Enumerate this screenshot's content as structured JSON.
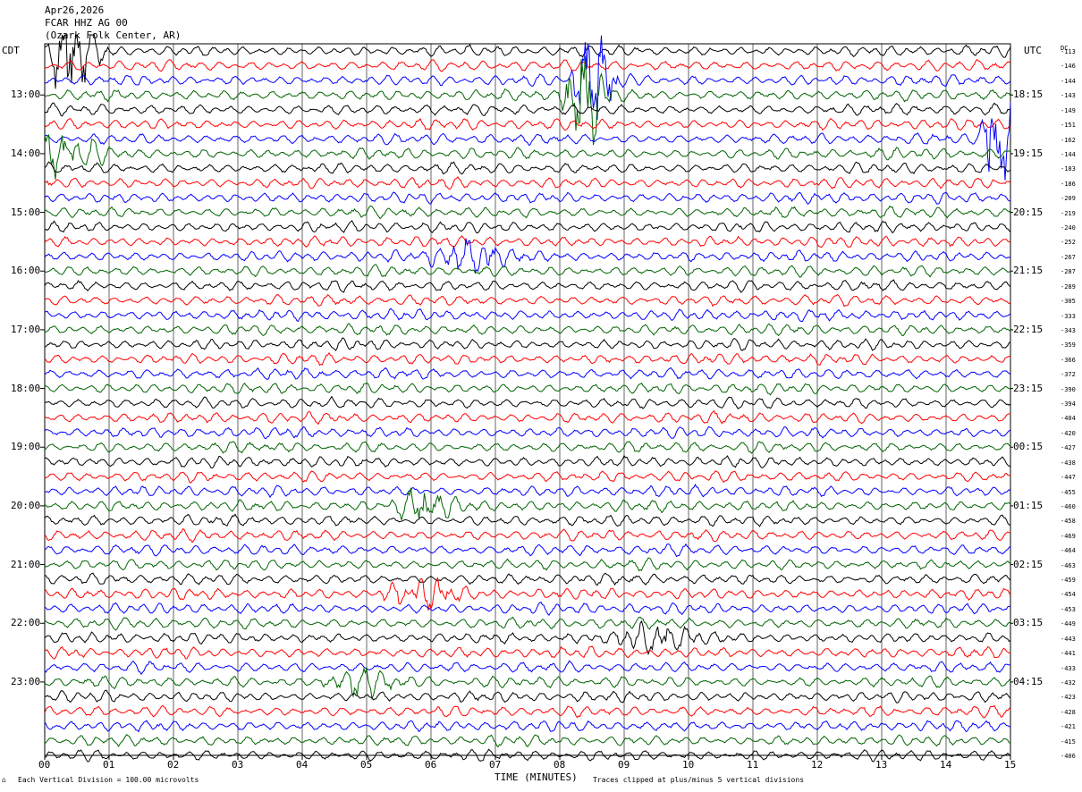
{
  "header": {
    "date": "Apr26,2026",
    "channel": "FCAR HHZ AG 00",
    "station": "(Ozark Folk Center, AR)"
  },
  "left_axis_title": "CDT",
  "right_axis_title": "UTC",
  "dc_title": "DC",
  "footer": {
    "scale_note": "Each Vertical Division =  100.00 microvolts",
    "xlabel": "TIME (MINUTES)",
    "clip_note": "Traces clipped at plus/minus 5 vertical divisions"
  },
  "colors": {
    "black": "#000000",
    "red": "#ff0000",
    "blue": "#0000ff",
    "green": "#006400",
    "grid": "#000000"
  },
  "chart_data": {
    "type": "line",
    "title": "FCAR HHZ AG 00 (Ozark Folk Center, AR)",
    "xlabel": "TIME (MINUTES)",
    "xlim": [
      0,
      15
    ],
    "x_ticks": [
      "00",
      "01",
      "02",
      "03",
      "04",
      "05",
      "06",
      "07",
      "08",
      "09",
      "10",
      "11",
      "12",
      "13",
      "14",
      "15"
    ],
    "trace_minutes": 15,
    "traces_per_hour": 4,
    "trace_color_cycle": [
      "black",
      "red",
      "blue",
      "green"
    ],
    "left_hour_labels": [
      "13:00",
      "14:00",
      "15:00",
      "16:00",
      "17:00",
      "18:00",
      "19:00",
      "20:00",
      "21:00",
      "22:00",
      "23:00"
    ],
    "right_hour_labels": [
      "18:15",
      "19:15",
      "20:15",
      "21:15",
      "22:15",
      "23:15",
      "00:15",
      "01:15",
      "02:15",
      "03:15",
      "04:15"
    ],
    "dc_offsets": [
      -113,
      -146,
      -144,
      -143,
      -149,
      -151,
      -162,
      -144,
      -183,
      -186,
      -209,
      -219,
      -240,
      -252,
      -267,
      -287,
      -289,
      -305,
      -333,
      -343,
      -359,
      -366,
      -372,
      -390,
      -394,
      -404,
      -420,
      -427,
      -438,
      -447,
      -455,
      -460,
      -458,
      -469,
      -464,
      -463,
      -459,
      -454,
      -453,
      -449,
      -443,
      -441,
      -433,
      -432,
      -423,
      -428,
      -421,
      -415,
      -406
    ],
    "events": [
      {
        "trace": 0,
        "x_minutes": 0.45,
        "strength": 5,
        "color": "black"
      },
      {
        "trace": 3,
        "x_minutes": 8.35,
        "strength": 5,
        "color": "green"
      },
      {
        "trace": 2,
        "x_minutes": 8.55,
        "strength": 4,
        "color": "blue"
      },
      {
        "trace": 6,
        "x_minutes": 14.85,
        "strength": 5,
        "color": "blue"
      },
      {
        "trace": 7,
        "x_minutes": 0.2,
        "strength": 2,
        "color": "green"
      },
      {
        "trace": 14,
        "x_minutes": 6.6,
        "strength": 1.5,
        "color": "blue"
      },
      {
        "trace": 31,
        "x_minutes": 5.9,
        "strength": 1.5,
        "color": "green"
      },
      {
        "trace": 37,
        "x_minutes": 5.8,
        "strength": 1.5,
        "color": "red"
      },
      {
        "trace": 40,
        "x_minutes": 9.5,
        "strength": 1.5,
        "color": "black"
      },
      {
        "trace": 43,
        "x_minutes": 4.9,
        "strength": 1.5,
        "color": "green"
      }
    ]
  }
}
